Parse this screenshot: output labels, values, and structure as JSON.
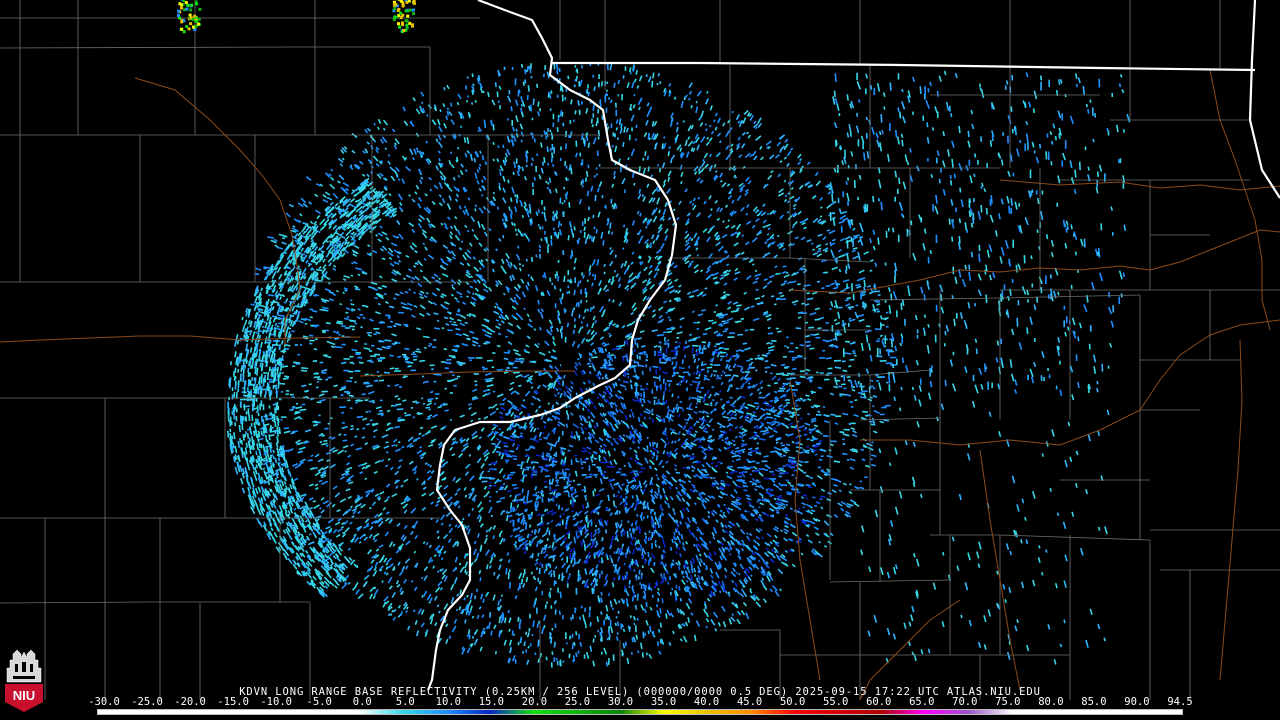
{
  "product": {
    "caption": "KDVN LONG RANGE BASE REFLECTIVITY (0.25KM / 256 LEVEL) (000000/0000 0.5 DEG) 2025-09-15 17:22 UTC  ATLAS.NIU.EDU"
  },
  "color_scale": {
    "labels": [
      "-30.0",
      "-25.0",
      "-20.0",
      "-15.0",
      "-10.0",
      "-5.0",
      "0.0",
      "5.0",
      "10.0",
      "15.0",
      "20.0",
      "25.0",
      "30.0",
      "35.0",
      "40.0",
      "45.0",
      "50.0",
      "55.0",
      "60.0",
      "65.0",
      "70.0",
      "75.0",
      "80.0",
      "85.0",
      "90.0",
      "94.5"
    ],
    "stops": [
      {
        "dbz": -30,
        "color": "#ffffff"
      },
      {
        "dbz": 0,
        "color": "#ffffff"
      },
      {
        "dbz": 5,
        "color": "#37d7e8"
      },
      {
        "dbz": 10,
        "color": "#1e90ff"
      },
      {
        "dbz": 15,
        "color": "#0a24c8"
      },
      {
        "dbz": 20,
        "color": "#12e012"
      },
      {
        "dbz": 25,
        "color": "#0eb40e"
      },
      {
        "dbz": 30,
        "color": "#0a820a"
      },
      {
        "dbz": 35,
        "color": "#ffff00"
      },
      {
        "dbz": 40,
        "color": "#e6c000"
      },
      {
        "dbz": 45,
        "color": "#ff8c00"
      },
      {
        "dbz": 50,
        "color": "#ff0000"
      },
      {
        "dbz": 55,
        "color": "#d40000"
      },
      {
        "dbz": 60,
        "color": "#b00000"
      },
      {
        "dbz": 65,
        "color": "#ff00ff"
      },
      {
        "dbz": 70,
        "color": "#9955c9"
      },
      {
        "dbz": 75,
        "color": "#ffffff"
      },
      {
        "dbz": 94.5,
        "color": "#ffffff"
      }
    ]
  },
  "map_colors": {
    "background": "#000000",
    "state_border": "#ffffff",
    "county_line": "#6e6e6e",
    "river": "#8b4a1a",
    "radar_site": "#000000"
  },
  "logo": {
    "text": "NIU",
    "accent": "#c8102e"
  }
}
